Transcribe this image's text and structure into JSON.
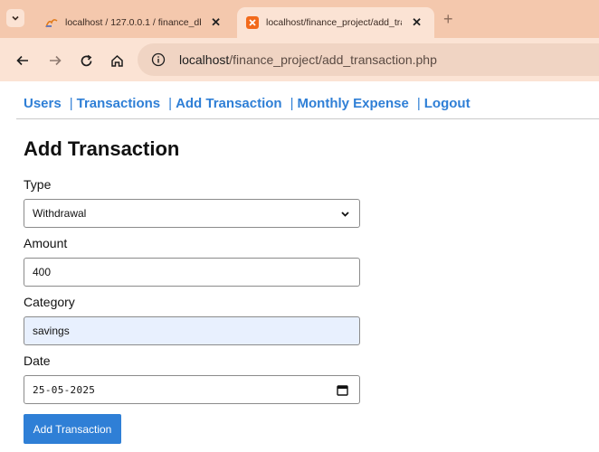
{
  "browser": {
    "tabs": [
      {
        "title": "localhost / 127.0.0.1 / finance_db /",
        "active": false
      },
      {
        "title": "localhost/finance_project/add_tran",
        "active": true
      }
    ],
    "url_host": "localhost",
    "url_path": "/finance_project/add_transaction.php"
  },
  "nav": {
    "items": [
      "Users",
      "Transactions",
      "Add Transaction",
      "Monthly Expense",
      "Logout"
    ],
    "separator": "|"
  },
  "page": {
    "title": "Add Transaction"
  },
  "form": {
    "type_label": "Type",
    "type_value": "Withdrawal",
    "amount_label": "Amount",
    "amount_value": "400",
    "category_label": "Category",
    "category_value": "savings",
    "date_label": "Date",
    "date_value": "25-05-2025",
    "submit_label": "Add Transaction"
  },
  "colors": {
    "accent": "#2f7fd6",
    "chrome_tabstrip": "#f4c8ad",
    "chrome_toolbar": "#fbe3d4",
    "autofill_bg": "#e8f0fe"
  }
}
